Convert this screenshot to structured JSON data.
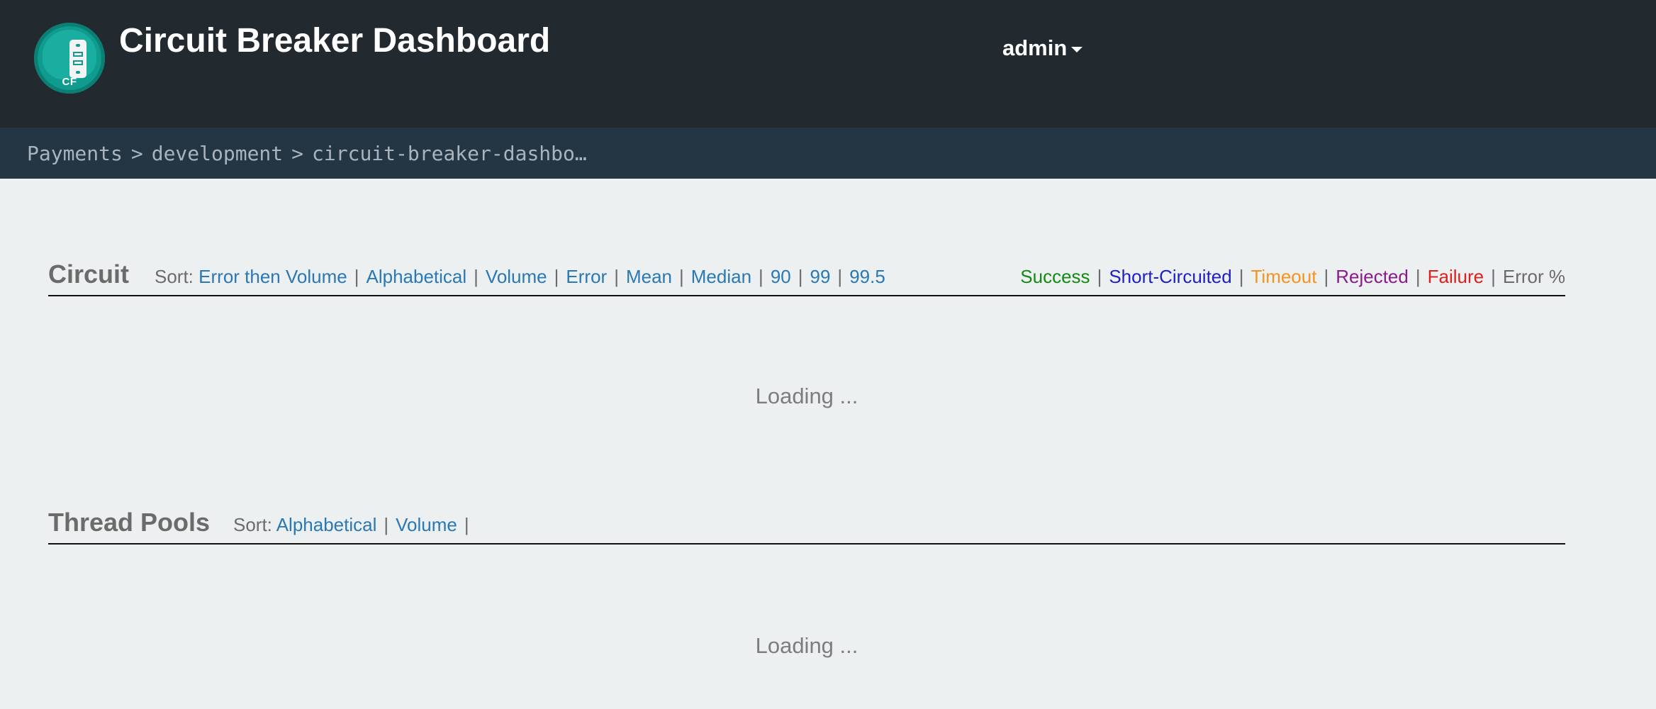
{
  "header": {
    "title": "Circuit Breaker Dashboard",
    "logo_text": "CF",
    "user": "admin"
  },
  "breadcrumb": {
    "items": [
      "Payments",
      "development",
      "circuit-breaker-dashbo…"
    ],
    "separator": ">"
  },
  "circuit": {
    "title": "Circuit",
    "sort_label": "Sort:",
    "sort_options": [
      "Error then Volume",
      "Alphabetical",
      "Volume",
      "Error",
      "Mean",
      "Median",
      "90",
      "99",
      "99.5"
    ],
    "legend": [
      {
        "label": "Success",
        "color": "#138a13"
      },
      {
        "label": "Short-Circuited",
        "color": "#1f1fc9"
      },
      {
        "label": "Timeout",
        "color": "#f6921e"
      },
      {
        "label": "Rejected",
        "color": "#8b1a8b"
      },
      {
        "label": "Failure",
        "color": "#e01e1e"
      },
      {
        "label": "Error %",
        "color": "#6b6b6b"
      }
    ],
    "loading": "Loading ..."
  },
  "thread_pools": {
    "title": "Thread Pools",
    "sort_label": "Sort:",
    "sort_options": [
      "Alphabetical",
      "Volume"
    ],
    "loading": "Loading ..."
  },
  "colors": {
    "topbar": "#232a2f",
    "breadcrumb_bar": "#243644",
    "page_bg": "#ecf0f1",
    "link": "#2a78b4",
    "logo": "#0f9b8e"
  }
}
